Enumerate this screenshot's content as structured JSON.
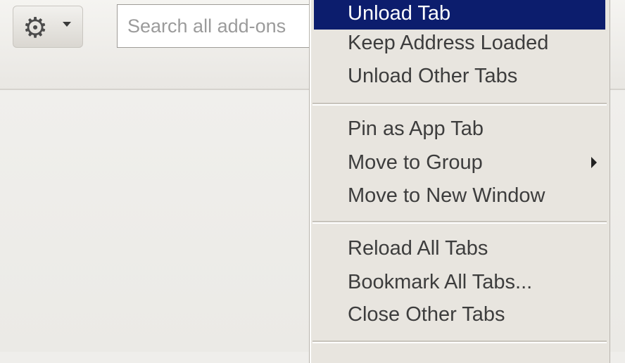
{
  "toolbar": {
    "gear_icon": "gear-icon",
    "search_placeholder": "Search all add-ons"
  },
  "menu": {
    "highlight_color": "#0c1d6d",
    "items": [
      {
        "label": "Unload Tab"
      },
      {
        "label": "Keep Address Loaded"
      },
      {
        "label": "Unload Other Tabs"
      },
      {
        "label": "Pin as App Tab"
      },
      {
        "label": "Move to Group"
      },
      {
        "label": "Move to New Window"
      },
      {
        "label": "Reload All Tabs"
      },
      {
        "label": "Bookmark All Tabs..."
      },
      {
        "label": "Close Other Tabs"
      }
    ]
  }
}
